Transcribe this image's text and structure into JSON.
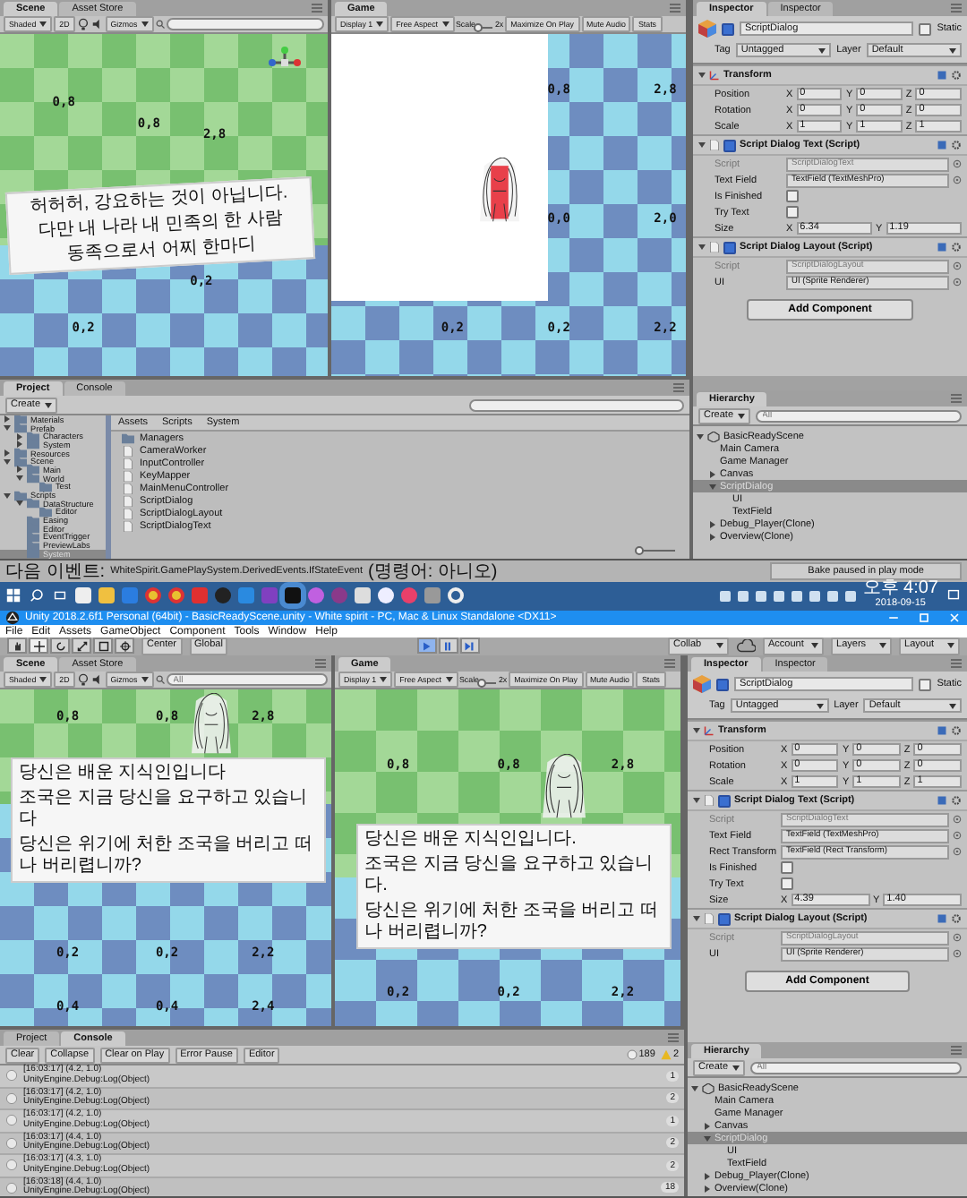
{
  "top": {
    "scene": {
      "tabs": [
        {
          "label": "Scene",
          "selected": true
        },
        {
          "label": "Asset Store",
          "selected": false
        }
      ],
      "toolbar": [
        {
          "kind": "dropdown",
          "label": "Shaded"
        },
        {
          "kind": "toggle",
          "label": "2D"
        },
        {
          "kind": "lighting"
        },
        {
          "kind": "audio"
        },
        {
          "kind": "dropdown",
          "label": "Gizmos"
        },
        {
          "kind": "search"
        }
      ],
      "grid_labels": [
        "0,8",
        "0,8",
        "2,8",
        "0,2",
        "0,2"
      ],
      "dialog_lines": [
        "허허허, 강요하는 것이 아닙니다.",
        "다만 내 나라 내 민족의 한 사람",
        "동족으로서 어찌 한마디"
      ]
    },
    "game": {
      "tabs": [
        {
          "label": "Game",
          "selected": true
        }
      ],
      "toolbar": [
        {
          "kind": "dropdown",
          "label": "Display 1"
        },
        {
          "kind": "dropdown",
          "label": "Free Aspect"
        },
        {
          "kind": "label",
          "label": "Scale"
        },
        {
          "kind": "slider",
          "level": 0.1
        },
        {
          "kind": "label",
          "label": "2x"
        },
        {
          "kind": "toggle",
          "label": "Maximize On Play"
        },
        {
          "kind": "toggle",
          "label": "Mute Audio"
        },
        {
          "kind": "toggle",
          "label": "Stats"
        }
      ],
      "grid_labels": [
        "0,8",
        "2,8",
        "0,0",
        "2,0",
        "0,2",
        "0,2",
        "2,2"
      ]
    },
    "inspector": {
      "tabs": [
        {
          "label": "Inspector",
          "selected": true
        },
        {
          "label": "Inspector",
          "selected": false
        }
      ],
      "active": true,
      "name": "ScriptDialog",
      "static": false,
      "static_label": "Static",
      "tag_label": "Tag",
      "tag": "Untagged",
      "layer_label": "Layer",
      "layer": "Default",
      "components": [
        {
          "kind": "transform",
          "title": "Transform",
          "rows": [
            {
              "label": "Position",
              "values": [
                {
                  "axis": "X",
                  "value": "0"
                },
                {
                  "axis": "Y",
                  "value": "0"
                },
                {
                  "axis": "Z",
                  "value": "0"
                }
              ]
            },
            {
              "label": "Rotation",
              "values": [
                {
                  "axis": "X",
                  "value": "0"
                },
                {
                  "axis": "Y",
                  "value": "0"
                },
                {
                  "axis": "Z",
                  "value": "0"
                }
              ]
            },
            {
              "label": "Scale",
              "values": [
                {
                  "axis": "X",
                  "value": "1"
                },
                {
                  "axis": "Y",
                  "value": "1"
                },
                {
                  "axis": "Z",
                  "value": "1"
                }
              ]
            }
          ]
        },
        {
          "kind": "script",
          "title": "Script Dialog Text (Script)",
          "enabled": true,
          "fields": [
            {
              "kind": "ref",
              "label": "Script",
              "value": "ScriptDialogText",
              "disabled": true
            },
            {
              "kind": "ref",
              "label": "Text Field",
              "value": "TextField (TextMeshPro)",
              "disabled": false
            },
            {
              "kind": "check",
              "label": "Is Finished",
              "checked": false
            },
            {
              "kind": "check",
              "label": "Try Text",
              "checked": false
            },
            {
              "kind": "vec",
              "label": "Size",
              "values": [
                {
                  "axis": "X",
                  "value": "6.34"
                },
                {
                  "axis": "Y",
                  "value": "1.19"
                }
              ]
            }
          ]
        },
        {
          "kind": "script",
          "title": "Script Dialog Layout (Script)",
          "enabled": true,
          "fields": [
            {
              "kind": "ref",
              "label": "Script",
              "value": "ScriptDialogLayout",
              "disabled": true
            },
            {
              "kind": "ref",
              "label": "UI",
              "value": "UI (Sprite Renderer)",
              "disabled": false
            }
          ]
        }
      ],
      "add_button": "Add Component"
    },
    "project": {
      "tabs": [
        {
          "label": "Project",
          "selected": true
        },
        {
          "label": "Console",
          "selected": false
        }
      ],
      "create": "Create",
      "tree": [
        {
          "name": "Materials",
          "expanded": false,
          "selected": false
        },
        {
          "name": "Prefab",
          "expanded": true,
          "selected": false,
          "children": [
            {
              "name": "Characters",
              "expanded": false,
              "selected": false
            },
            {
              "name": "System",
              "expanded": false,
              "selected": false
            }
          ]
        },
        {
          "name": "Resources",
          "expanded": false,
          "selected": false
        },
        {
          "name": "Scene",
          "expanded": true,
          "selected": false,
          "children": [
            {
              "name": "Main",
              "expanded": false,
              "selected": false
            },
            {
              "name": "World",
              "expanded": true,
              "selected": false,
              "children": [
                {
                  "name": "Test",
                  "selected": false
                }
              ]
            }
          ]
        },
        {
          "name": "Scripts",
          "expanded": true,
          "selected": false,
          "children": [
            {
              "name": "DataStructure",
              "expanded": true,
              "selected": false,
              "children": [
                {
                  "name": "Editor",
                  "selected": false
                }
              ]
            },
            {
              "name": "Easing",
              "selected": false
            },
            {
              "name": "Editor",
              "selected": false
            },
            {
              "name": "EventTrigger",
              "selected": false
            },
            {
              "name": "PreviewLabs",
              "selected": false
            },
            {
              "name": "System",
              "selected": true
            }
          ]
        }
      ],
      "breadcrumb": [
        "Assets",
        "Scripts",
        "System"
      ],
      "files": [
        {
          "kind": "folder",
          "name": "Managers"
        },
        {
          "kind": "script",
          "name": "CameraWorker"
        },
        {
          "kind": "script",
          "name": "InputController"
        },
        {
          "kind": "script",
          "name": "KeyMapper"
        },
        {
          "kind": "script",
          "name": "MainMenuController"
        },
        {
          "kind": "script",
          "name": "ScriptDialog"
        },
        {
          "kind": "script",
          "name": "ScriptDialogLayout"
        },
        {
          "kind": "script",
          "name": "ScriptDialogText"
        }
      ],
      "zoom_slider": {
        "level": 0.1
      }
    },
    "hierarchy": {
      "tabs": [
        {
          "label": "Hierarchy",
          "selected": true
        }
      ],
      "create": "Create",
      "search_placeholder": "All",
      "items": [
        {
          "name": "BasicReadyScene",
          "expanded": true,
          "selected": false,
          "children": [
            {
              "name": "Main Camera",
              "selected": false
            },
            {
              "name": "Game Manager",
              "selected": false
            },
            {
              "name": "Canvas",
              "expanded": false,
              "selected": false
            },
            {
              "name": "ScriptDialog",
              "expanded": true,
              "selected": true,
              "children": [
                {
                  "name": "UI",
                  "selected": false
                },
                {
                  "name": "TextField",
                  "selected": false
                }
              ]
            },
            {
              "name": "Debug_Player(Clone)",
              "expanded": false,
              "selected": false
            },
            {
              "name": "Overview(Clone)",
              "expanded": false,
              "selected": false
            }
          ]
        }
      ]
    },
    "status": {
      "prefix": "다음 이벤트:",
      "event": "WhiteSpirit.GamePlaySystem.DerivedEvents.IfStateEvent",
      "suffix": "(명령어: 아니오)",
      "bake": "Bake paused in play mode"
    },
    "taskbar": {
      "time": "오후 4:07",
      "date": "2018-09-15"
    }
  },
  "bottom": {
    "title": "Unity 2018.2.6f1 Personal (64bit) - BasicReadyScene.unity - White spirit - PC, Mac & Linux Standalone <DX11>",
    "menu": [
      "File",
      "Edit",
      "Assets",
      "GameObject",
      "Component",
      "Tools",
      "Window",
      "Help"
    ],
    "tools": [
      {
        "kind": "hand",
        "selected": false
      },
      {
        "kind": "move",
        "selected": true
      },
      {
        "kind": "rotate",
        "selected": false
      },
      {
        "kind": "scale",
        "selected": false
      },
      {
        "kind": "rect",
        "selected": false
      },
      {
        "kind": "transform",
        "selected": false
      }
    ],
    "pivot": [
      "Center",
      "Global"
    ],
    "playback": [
      {
        "kind": "play",
        "on": true
      },
      {
        "kind": "pause",
        "on": false
      },
      {
        "kind": "step",
        "on": false
      }
    ],
    "right_menus": [
      "Collab",
      "Account",
      "Layers",
      "Layout"
    ],
    "scene": {
      "tabs": [
        {
          "label": "Scene",
          "selected": true
        },
        {
          "label": "Asset Store",
          "selected": false
        }
      ],
      "toolbar": [
        {
          "kind": "dropdown",
          "label": "Shaded"
        },
        {
          "kind": "toggle",
          "label": "2D"
        },
        {
          "kind": "lighting"
        },
        {
          "kind": "audio"
        },
        {
          "kind": "dropdown",
          "label": "Gizmos"
        },
        {
          "kind": "search",
          "placeholder": "All"
        }
      ],
      "grid_labels": [
        "0,8",
        "0,8",
        "2,8",
        "0,2",
        "0,2",
        "2,2",
        "0,4",
        "0,4",
        "2,4"
      ],
      "dialog_lines": [
        "당신은 배운 지식인입니다",
        "조국은 지금 당신을 요구하고 있습니다",
        "당신은 위기에 처한 조국을 버리고 떠나 버리렵니까?"
      ]
    },
    "game": {
      "tabs": [
        {
          "label": "Game",
          "selected": true
        }
      ],
      "toolbar": [
        {
          "kind": "dropdown",
          "label": "Display 1"
        },
        {
          "kind": "dropdown",
          "label": "Free Aspect"
        },
        {
          "kind": "label",
          "label": "Scale"
        },
        {
          "kind": "slider",
          "level": 0.1
        },
        {
          "kind": "label",
          "label": "2x"
        },
        {
          "kind": "toggle",
          "label": "Maximize On Play"
        },
        {
          "kind": "toggle",
          "label": "Mute Audio"
        },
        {
          "kind": "toggle",
          "label": "Stats"
        }
      ],
      "grid_labels": [
        "0,8",
        "0,8",
        "2,8",
        "0,2",
        "0,2",
        "2,2"
      ],
      "dialog_lines": [
        "당신은 배운 지식인입니다.",
        "조국은 지금 당신을 요구하고 있습니다.",
        "당신은 위기에 처한 조국을 버리고 떠나 버리렵니까?"
      ]
    },
    "inspector": {
      "tabs": [
        {
          "label": "Inspector",
          "selected": true
        },
        {
          "label": "Inspector",
          "selected": false
        }
      ],
      "active": true,
      "name": "ScriptDialog",
      "static": false,
      "static_label": "Static",
      "tag_label": "Tag",
      "tag": "Untagged",
      "layer_label": "Layer",
      "layer": "Default",
      "components": [
        {
          "kind": "transform",
          "title": "Transform",
          "rows": [
            {
              "label": "Position",
              "values": [
                {
                  "axis": "X",
                  "value": "0"
                },
                {
                  "axis": "Y",
                  "value": "0"
                },
                {
                  "axis": "Z",
                  "value": "0"
                }
              ]
            },
            {
              "label": "Rotation",
              "values": [
                {
                  "axis": "X",
                  "value": "0"
                },
                {
                  "axis": "Y",
                  "value": "0"
                },
                {
                  "axis": "Z",
                  "value": "0"
                }
              ]
            },
            {
              "label": "Scale",
              "values": [
                {
                  "axis": "X",
                  "value": "1"
                },
                {
                  "axis": "Y",
                  "value": "1"
                },
                {
                  "axis": "Z",
                  "value": "1"
                }
              ]
            }
          ]
        },
        {
          "kind": "script",
          "title": "Script Dialog Text (Script)",
          "enabled": true,
          "fields": [
            {
              "kind": "ref",
              "label": "Script",
              "value": "ScriptDialogText",
              "disabled": true
            },
            {
              "kind": "ref",
              "label": "Text Field",
              "value": "TextField (TextMeshPro)",
              "disabled": false
            },
            {
              "kind": "ref",
              "label": "Rect Transform",
              "value": "TextField (Rect Transform)",
              "disabled": false
            },
            {
              "kind": "check",
              "label": "Is Finished",
              "checked": false
            },
            {
              "kind": "check",
              "label": "Try Text",
              "checked": false
            },
            {
              "kind": "vec",
              "label": "Size",
              "values": [
                {
                  "axis": "X",
                  "value": "4.39"
                },
                {
                  "axis": "Y",
                  "value": "1.40"
                }
              ]
            }
          ]
        },
        {
          "kind": "script",
          "title": "Script Dialog Layout (Script)",
          "enabled": true,
          "fields": [
            {
              "kind": "ref",
              "label": "Script",
              "value": "ScriptDialogLayout",
              "disabled": true
            },
            {
              "kind": "ref",
              "label": "UI",
              "value": "UI (Sprite Renderer)",
              "disabled": false
            }
          ]
        }
      ],
      "add_button": "Add Component"
    },
    "console": {
      "tabs": [
        {
          "label": "Project",
          "selected": false
        },
        {
          "label": "Console",
          "selected": true
        }
      ],
      "buttons": [
        "Clear",
        "Collapse",
        "Clear on Play",
        "Error Pause",
        "Editor"
      ],
      "counts": [
        {
          "kind": "info",
          "value": "189"
        },
        {
          "kind": "warning",
          "value": "2"
        }
      ],
      "entries": [
        {
          "time": "[16:03:17] (4.2, 1.0)",
          "source": "UnityEngine.Debug:Log(Object)",
          "count": "1"
        },
        {
          "time": "[16:03:17] (4.2, 1.0)",
          "source": "UnityEngine.Debug:Log(Object)",
          "count": "2"
        },
        {
          "time": "[16:03:17] (4.2, 1.0)",
          "source": "UnityEngine.Debug:Log(Object)",
          "count": "1"
        },
        {
          "time": "[16:03:17] (4.4, 1.0)",
          "source": "UnityEngine.Debug:Log(Object)",
          "count": "2"
        },
        {
          "time": "[16:03:17] (4.3, 1.0)",
          "source": "UnityEngine.Debug:Log(Object)",
          "count": "2"
        },
        {
          "time": "[16:03:18] (4.4, 1.0)",
          "source": "UnityEngine.Debug:Log(Object)",
          "count": "18"
        }
      ]
    },
    "hierarchy": {
      "tabs": [
        {
          "label": "Hierarchy",
          "selected": true
        }
      ],
      "create": "Create",
      "search_placeholder": "All",
      "items": [
        {
          "name": "BasicReadyScene",
          "expanded": true,
          "selected": false,
          "children": [
            {
              "name": "Main Camera",
              "selected": false
            },
            {
              "name": "Game Manager",
              "selected": false
            },
            {
              "name": "Canvas",
              "expanded": false,
              "selected": false
            },
            {
              "name": "ScriptDialog",
              "expanded": true,
              "selected": true,
              "children": [
                {
                  "name": "UI",
                  "selected": false
                },
                {
                  "name": "TextField",
                  "selected": false
                }
              ]
            },
            {
              "name": "Debug_Player(Clone)",
              "expanded": false,
              "selected": false
            },
            {
              "name": "Overview(Clone)",
              "expanded": false,
              "selected": false
            }
          ]
        }
      ]
    }
  }
}
